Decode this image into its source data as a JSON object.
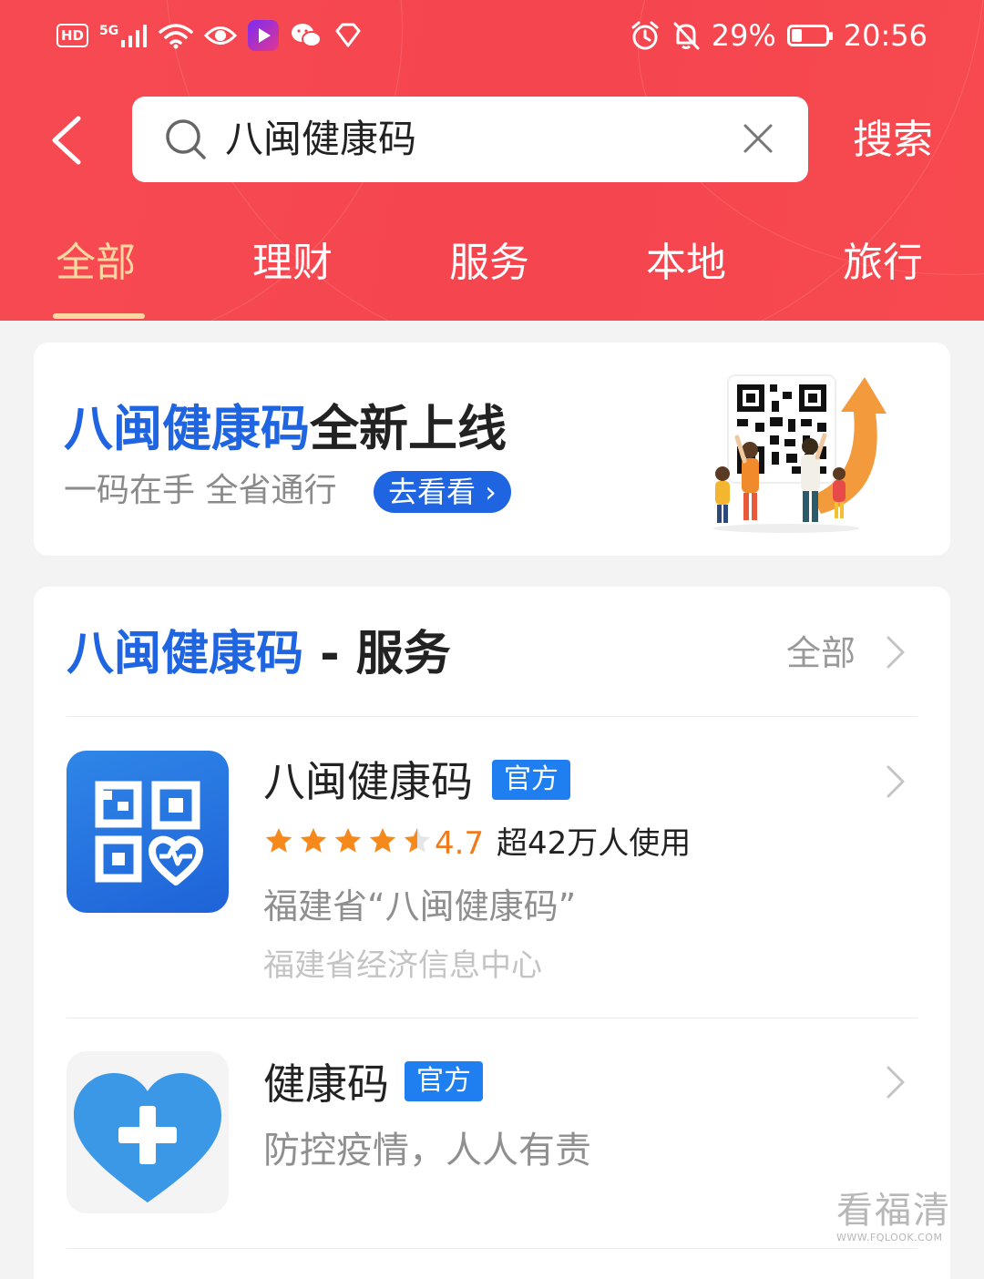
{
  "status_bar": {
    "hd": "HD",
    "network": "5G",
    "battery": "29%",
    "time": "20:56"
  },
  "search": {
    "query": "八闽健康码",
    "button": "搜索"
  },
  "tabs": [
    {
      "label": "全部",
      "active": true
    },
    {
      "label": "理财",
      "active": false
    },
    {
      "label": "服务",
      "active": false
    },
    {
      "label": "本地",
      "active": false
    },
    {
      "label": "旅行",
      "active": false
    }
  ],
  "banner": {
    "title_highlight": "八闽健康码",
    "title_rest": "全新上线",
    "subtitle": "一码在手 全省通行",
    "cta": "去看看 ›"
  },
  "services": {
    "title_highlight": "八闽健康码",
    "title_rest": " - 服务",
    "all_link": "全部",
    "items": [
      {
        "name": "八闽健康码",
        "badge": "官方",
        "rating": "4.7",
        "stars": 4.5,
        "users": "超42万人使用",
        "desc": "福建省“八闽健康码”",
        "org": "福建省经济信息中心"
      },
      {
        "name": "健康码",
        "badge": "官方",
        "desc": "防控疫情，人人有责"
      }
    ]
  },
  "watermark": {
    "text": "看福清",
    "url": "WWW.FQLOOK.COM"
  },
  "colors": {
    "header_red": "#f5454f",
    "active_tab": "#fcd7a0",
    "brand_blue": "#1f64e0",
    "badge_blue": "#1f7ff0",
    "star_orange": "#f07a1c"
  }
}
